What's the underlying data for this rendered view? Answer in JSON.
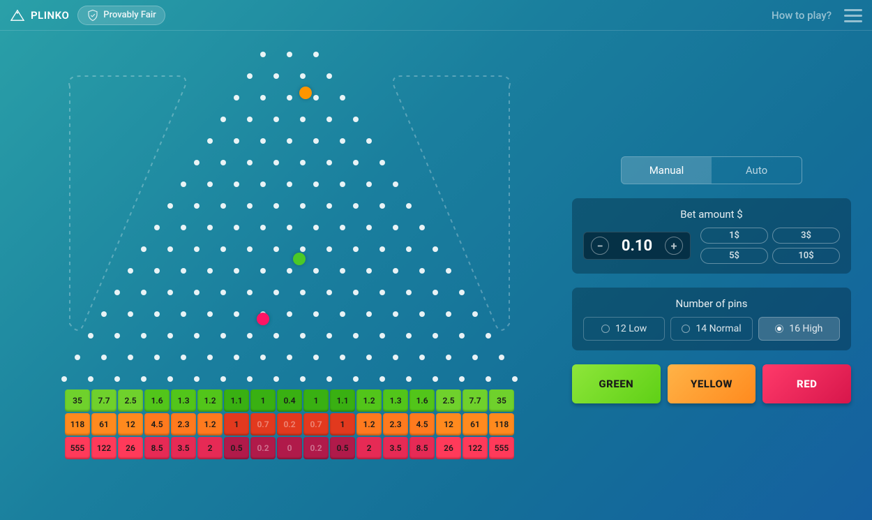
{
  "header": {
    "title": "PLINKO",
    "provably_fair": "Provably Fair",
    "help": "How to play?"
  },
  "mode_toggle": {
    "manual": "Manual",
    "auto": "Auto",
    "active": "manual"
  },
  "bet": {
    "label": "Bet amount $",
    "value": "0.10",
    "presets": [
      "1$",
      "3$",
      "5$",
      "10$"
    ]
  },
  "pins": {
    "label": "Number of pins",
    "options": [
      {
        "id": "12",
        "label": "12 Low"
      },
      {
        "id": "14",
        "label": "14 Normal"
      },
      {
        "id": "16",
        "label": "16 High"
      }
    ],
    "selected": "16"
  },
  "play_buttons": {
    "green": "GREEN",
    "yellow": "YELLOW",
    "red": "RED"
  },
  "board": {
    "rows": 16,
    "balls": [
      {
        "color": "orange",
        "top": 50,
        "left": 364
      },
      {
        "color": "green",
        "top": 288,
        "left": 355
      },
      {
        "color": "red",
        "top": 374,
        "left": 303
      }
    ]
  },
  "chart_data": {
    "type": "table",
    "title": "Plinko payout multipliers (16 pins)",
    "series": [
      {
        "name": "green",
        "values": [
          35,
          7.7,
          2.5,
          1.6,
          1.3,
          1.2,
          1.1,
          1,
          0.4,
          1,
          1.1,
          1.2,
          1.3,
          1.6,
          2.5,
          7.7,
          35
        ]
      },
      {
        "name": "yellow",
        "values": [
          118,
          61,
          12,
          4.5,
          2.3,
          1.2,
          1,
          0.7,
          0.2,
          0.7,
          1,
          1.2,
          2.3,
          4.5,
          12,
          61,
          118
        ]
      },
      {
        "name": "red",
        "values": [
          555,
          122,
          26,
          8.5,
          3.5,
          2,
          0.5,
          0.2,
          0,
          0.2,
          0.5,
          2,
          3.5,
          8.5,
          26,
          122,
          555
        ]
      }
    ],
    "colors": {
      "green": {
        "edge": "#6fd12c",
        "mid": "#52c51a",
        "center": "#39b012"
      },
      "yellow": {
        "edge": "#ff8a1e",
        "mid": "#ff7a1e",
        "center": "#e2391e"
      },
      "red": {
        "edge": "#ff3a5a",
        "mid": "#e62a55",
        "center": "#b01a4a"
      }
    }
  }
}
